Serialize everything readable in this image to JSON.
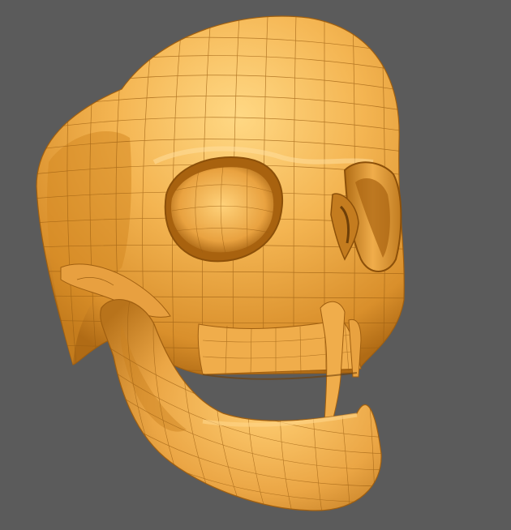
{
  "viewport": {
    "background_color": "#5b5b5b",
    "model_base_color": "#f2b24c",
    "model_highlight_color": "#ffd27a",
    "model_shadow_color": "#b8741a",
    "wireframe_color": "#9c5f12",
    "cavity_color": "#6e3f08"
  },
  "model": {
    "subject": "skull-icon",
    "shading": "smooth-with-wireframe"
  }
}
